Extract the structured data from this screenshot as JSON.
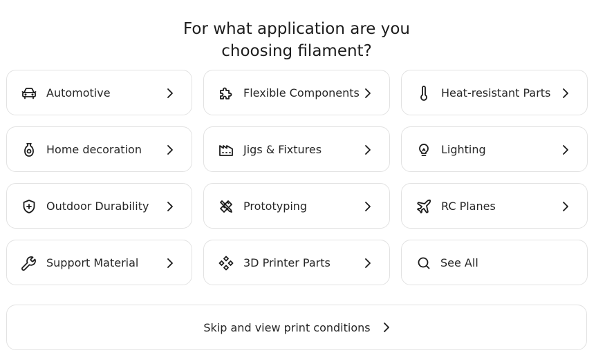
{
  "header": {
    "title_line1": "For what application are you",
    "title_line2": "choosing filament?"
  },
  "applications": [
    {
      "label": "Automotive",
      "icon": "car-icon"
    },
    {
      "label": "Flexible Components",
      "icon": "puzzle-icon"
    },
    {
      "label": "Heat-resistant Parts",
      "icon": "thermometer-icon"
    },
    {
      "label": "Home decoration",
      "icon": "vase-icon"
    },
    {
      "label": "Jigs & Fixtures",
      "icon": "factory-icon"
    },
    {
      "label": "Lighting",
      "icon": "lightbulb-icon"
    },
    {
      "label": "Outdoor Durability",
      "icon": "shield-plus-icon"
    },
    {
      "label": "Prototyping",
      "icon": "pencil-ruler-icon"
    },
    {
      "label": "RC Planes",
      "icon": "plane-icon"
    },
    {
      "label": "Support Material",
      "icon": "wrench-icon"
    },
    {
      "label": "3D Printer Parts",
      "icon": "component-icon"
    },
    {
      "label": "See All",
      "icon": "search-icon"
    }
  ],
  "skip": {
    "label": "Skip and view print conditions"
  },
  "colors": {
    "text": "#262626",
    "border": "#e2e2e2",
    "background": "#ffffff"
  }
}
